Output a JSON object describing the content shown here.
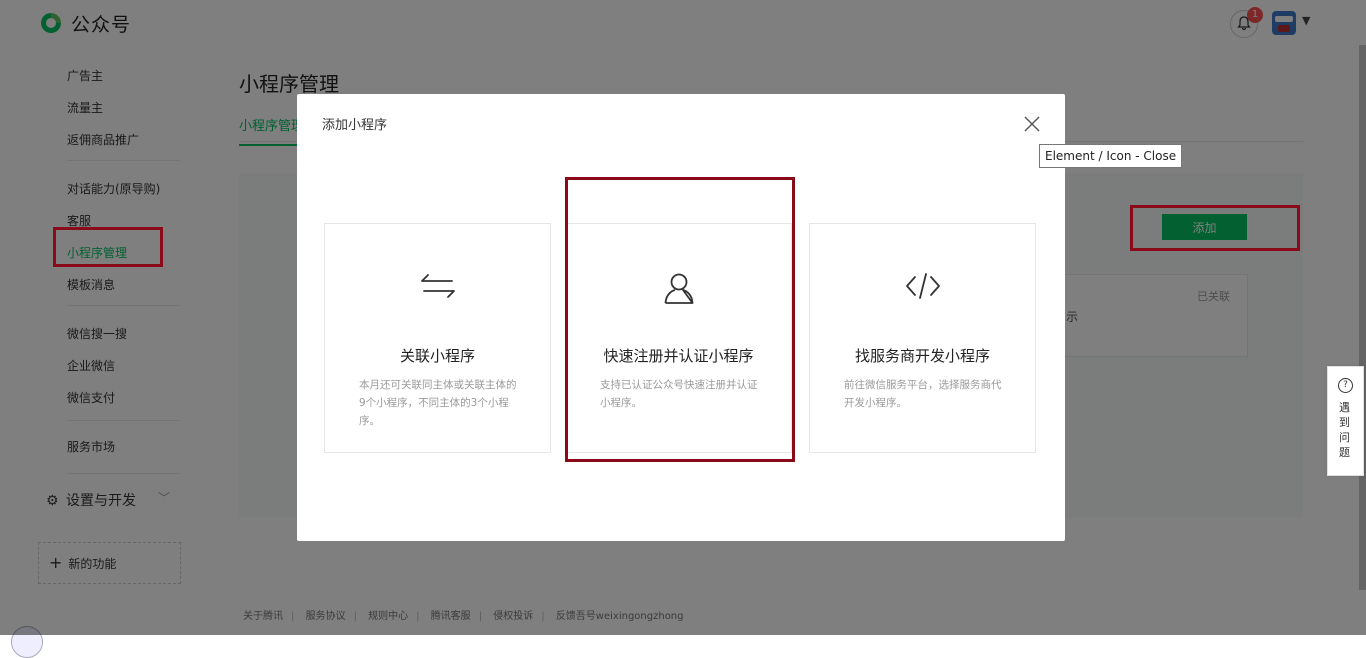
{
  "header": {
    "brand": "公众号",
    "notification_count": "1"
  },
  "sidebar": {
    "items": [
      {
        "label": "广告主"
      },
      {
        "label": "流量主"
      },
      {
        "label": "返佣商品推广"
      },
      {
        "label": "对话能力(原导购)"
      },
      {
        "label": "客服"
      },
      {
        "label": "小程序管理"
      },
      {
        "label": "模板消息"
      },
      {
        "label": "微信搜一搜"
      },
      {
        "label": "企业微信"
      },
      {
        "label": "微信支付"
      },
      {
        "label": "服务市场"
      }
    ],
    "group_label": "设置与开发",
    "new_feature_label": "新的功能"
  },
  "main": {
    "page_title": "小程序管理",
    "tab_label": "小程序管理",
    "add_button": "添加",
    "linked_status": "已关联",
    "linked_tip": "示"
  },
  "footer": {
    "links": [
      "关于腾讯",
      "服务协议",
      "规则中心",
      "腾讯客服",
      "侵权投诉",
      "反馈吾号weixingongzhong"
    ]
  },
  "helper": {
    "label": "遇到问题"
  },
  "dialog": {
    "title": "添加小程序",
    "close_tooltip": "Element / Icon - Close",
    "options": [
      {
        "title": "关联小程序",
        "desc": "本月还可关联同主体或关联主体的9个小程序，不同主体的3个小程序。",
        "icon": "swap-arrows-icon"
      },
      {
        "title": "快速注册并认证小程序",
        "desc": "支持已认证公众号快速注册并认证小程序。",
        "icon": "user-icon"
      },
      {
        "title": "找服务商开发小程序",
        "desc": "前往微信服务平台，选择服务商代开发小程序。",
        "icon": "code-icon"
      }
    ]
  },
  "colors": {
    "accent": "#07c160",
    "highlight": "#8a0a1a",
    "badge": "#fa5151"
  }
}
